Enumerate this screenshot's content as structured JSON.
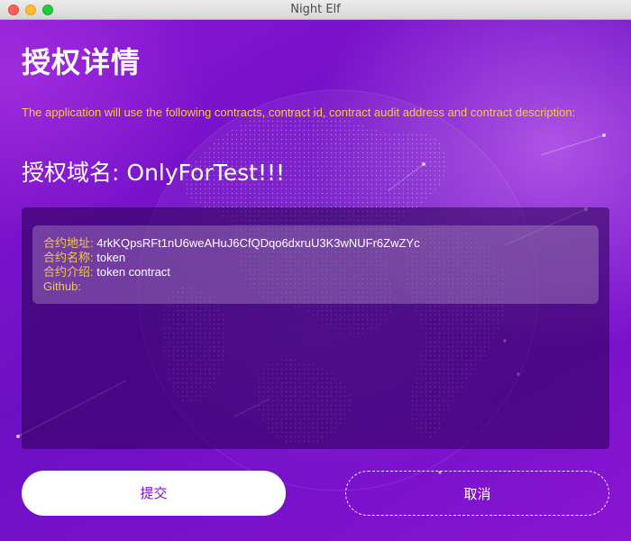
{
  "window": {
    "title": "Night Elf"
  },
  "page": {
    "title": "授权详情",
    "description": "The application will use the following contracts, contract id, contract audit address and contract description:",
    "domain_label": "授权域名:",
    "domain_value": "OnlyForTest!!!"
  },
  "contract": {
    "address_label": "合约地址:",
    "address_value": "4rkKQpsRFt1nU6weAHuJ6CfQDqo6dxruU3K3wNUFr6ZwZYc",
    "name_label": "合约名称:",
    "name_value": "token",
    "intro_label": "合约介绍:",
    "intro_value": "token contract",
    "github_label": "Github:",
    "github_value": ""
  },
  "buttons": {
    "submit_label": "提交",
    "cancel_label": "取消"
  },
  "colors": {
    "accent": "#f4c84a",
    "background": "#7a12cc",
    "submit_text": "#7a18c8"
  }
}
